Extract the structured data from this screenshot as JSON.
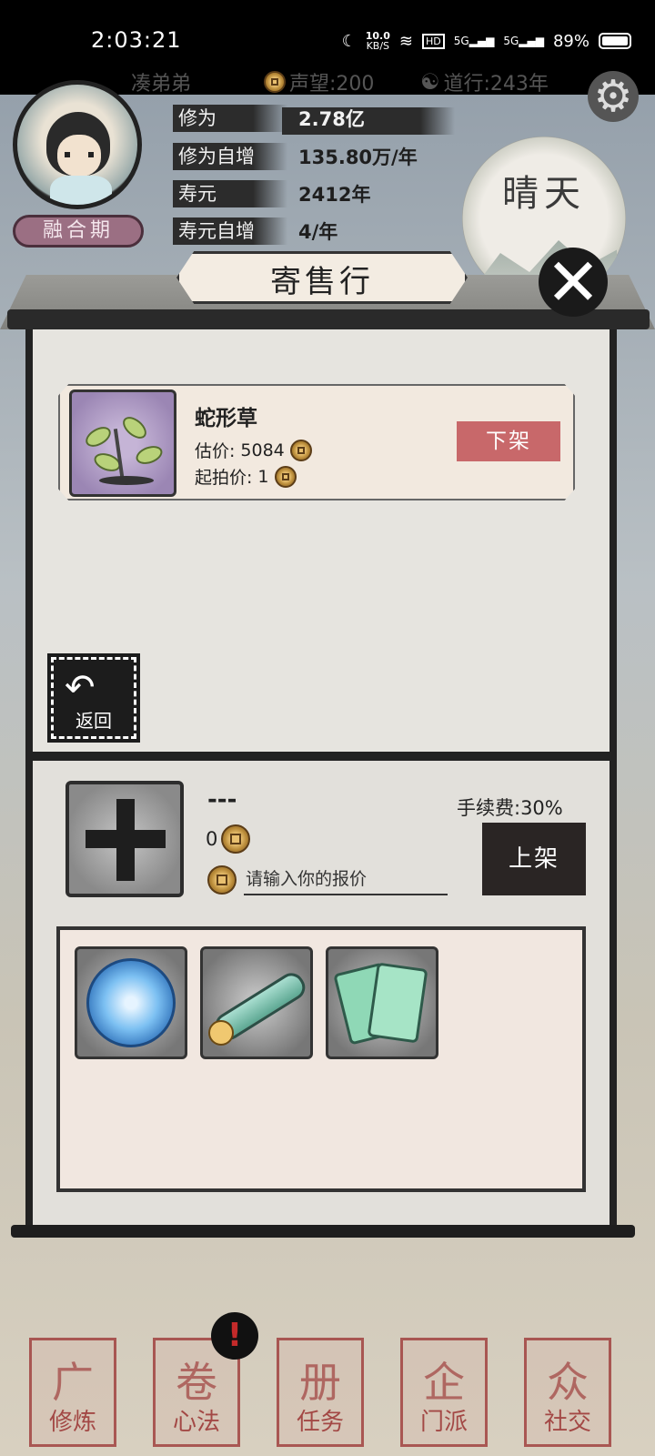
{
  "status_bar": {
    "time": "2:03:21",
    "net_speed_value": "10.0",
    "net_speed_unit": "KB/S",
    "hd_badge": "HD",
    "signal_1": "5G",
    "signal_2": "5G",
    "battery": "89%"
  },
  "header": {
    "player_name": "凑弟弟",
    "fame": "声望:200",
    "dao_years": "道行:243年"
  },
  "profile": {
    "realm": "融合期",
    "stats": [
      {
        "label": "修为",
        "value": "2.78亿"
      },
      {
        "label": "修为自增",
        "value": "135.80万/年"
      },
      {
        "label": "寿元",
        "value": "2412年"
      },
      {
        "label": "寿元自增",
        "value": "4/年"
      }
    ],
    "weather": "晴天"
  },
  "dialog": {
    "title": "寄售行",
    "close": "✕"
  },
  "listing": {
    "name": "蛇形草",
    "estimate_label": "估价:",
    "estimate_value": "5084",
    "start_label": "起拍价:",
    "start_value": "1",
    "delist_label": "下架"
  },
  "back": {
    "label": "返回",
    "arrow": "↶"
  },
  "sell_form": {
    "item_name": "---",
    "fee": "手续费:30%",
    "amount": "0",
    "price_placeholder": "请输入你的报价",
    "list_label": "上架"
  },
  "inventory": {
    "items": [
      {
        "icon": "spirit-orb-icon"
      },
      {
        "icon": "scroll-icon"
      },
      {
        "icon": "jade-cards-icon"
      }
    ]
  },
  "bottom_nav": {
    "items": [
      {
        "label": "修炼",
        "glyph": "⼴"
      },
      {
        "label": "心法",
        "glyph": "卷"
      },
      {
        "label": "任务",
        "glyph": "册"
      },
      {
        "label": "门派",
        "glyph": "企"
      },
      {
        "label": "社交",
        "glyph": "众"
      }
    ],
    "alert": "!"
  },
  "colors": {
    "delist_button": "#c8686a",
    "list_button": "#2a2524",
    "realm_badge": "#9b6f83",
    "nav_stamp": "#962828"
  }
}
